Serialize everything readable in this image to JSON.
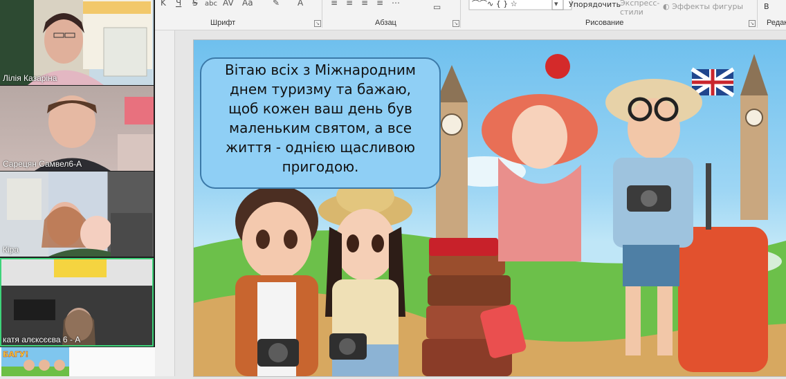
{
  "participants": [
    {
      "name": "Лілія Казаріна"
    },
    {
      "name": "Сарецян Самвел6-А"
    },
    {
      "name": "Кіра"
    },
    {
      "name": "катя алєксєєва 6 - А"
    }
  ],
  "ribbon": {
    "groups": [
      {
        "label": "Шрифт"
      },
      {
        "label": "Абзац"
      },
      {
        "label": "Рисование"
      },
      {
        "label": "Редак"
      }
    ],
    "arrange_label": "Упорядочить",
    "express_styles_label": "Экспресс-\nстили",
    "shape_effects_label": "Эффекты фигуры",
    "find_label": "В"
  },
  "slide": {
    "greeting_lines": [
      "Вітаю всіх з Міжнародним",
      "днем туризму та бажаю,",
      "щоб кожен ваш день був",
      "маленьким святом, а все",
      "життя - однією щасливою",
      "пригодою."
    ]
  },
  "thumbnail": {
    "caption": "БАГУ!"
  }
}
